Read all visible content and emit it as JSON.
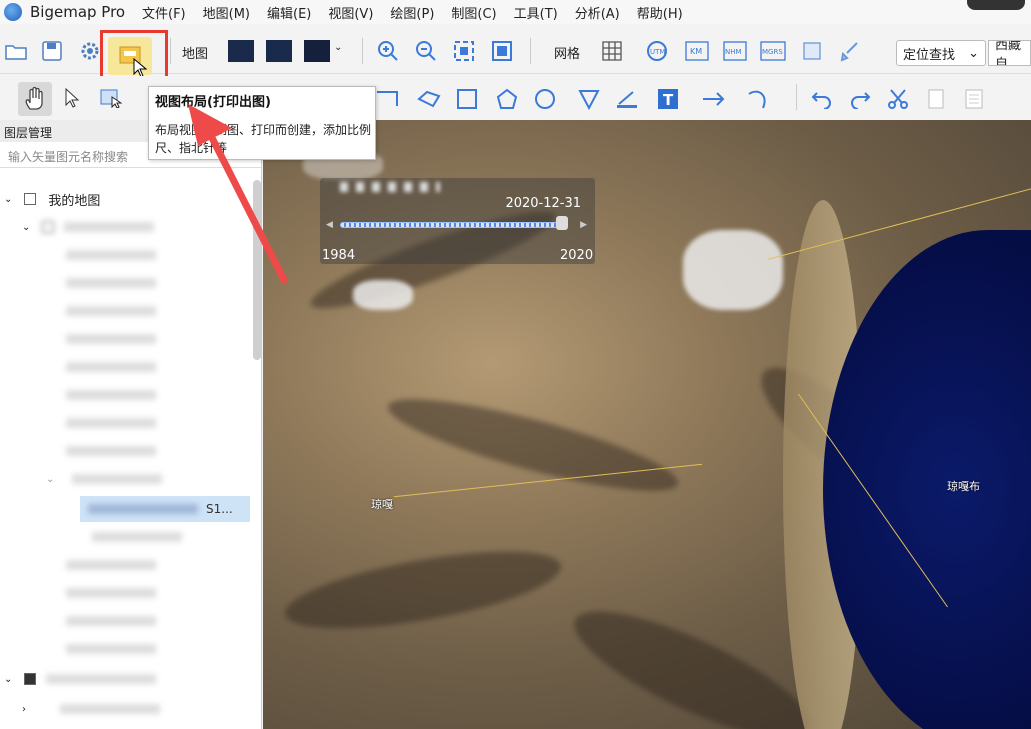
{
  "app": {
    "title": "Bigemap Pro"
  },
  "menu": [
    {
      "label": "文件(F)"
    },
    {
      "label": "地图(M)"
    },
    {
      "label": "编辑(E)"
    },
    {
      "label": "视图(V)"
    },
    {
      "label": "绘图(P)"
    },
    {
      "label": "制图(C)"
    },
    {
      "label": "工具(T)"
    },
    {
      "label": "分析(A)"
    },
    {
      "label": "帮助(H)"
    }
  ],
  "toolbar": {
    "map_label": "地图",
    "grid_label": "网格",
    "locate_select": "定位查找",
    "region_select": "西藏自"
  },
  "tooltip": {
    "title": "视图布局(打印出图)",
    "body": "布局视图为制图、打印而创建，添加比例尺、指北针等"
  },
  "sidebar": {
    "title": "图层管理",
    "search_placeholder": "输入矢量图元名称搜索",
    "root_label": "我的地图",
    "selected_suffix": "S1..."
  },
  "timeline": {
    "current_date": "2020-12-31",
    "start_year": "1984",
    "end_year": "2020",
    "position": 1.0
  },
  "map": {
    "place_1": "琼嘎",
    "place_2": "琼嘎布"
  },
  "colors": {
    "accent": "#1f5fb8",
    "highlight": "#e8392f",
    "lake": "#050d45"
  }
}
